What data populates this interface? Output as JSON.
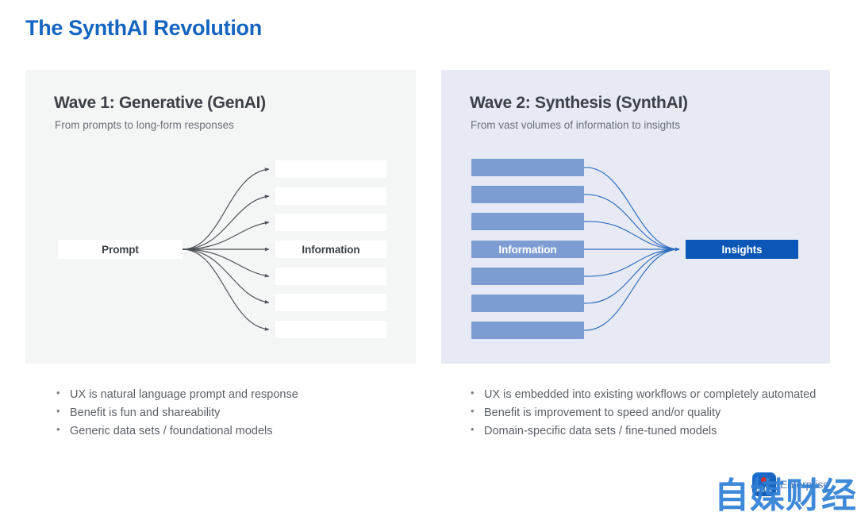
{
  "slide": {
    "title": "The SynthAI Revolution",
    "colors": {
      "title_blue": "#1565c0",
      "left_panel_bg": "#f4f5f5",
      "right_panel_bg": "#e7eaf4",
      "bar_blue": "#7d9cd2",
      "insights_blue": "#0b57b8",
      "arrow_gray": "#4a4f55",
      "arrow_blue": "#2c6bbd",
      "body_text": "#5c6066",
      "heading_text": "#3c4148"
    }
  },
  "panels": [
    {
      "id": "wave1",
      "title": "Wave 1: Generative (GenAI)",
      "subtitle": "From prompts to long-form responses",
      "source_node": "Prompt",
      "target_label": "Information",
      "bar_count": 7,
      "labeled_bar_index": 3,
      "flow_direction": "one-to-many",
      "bullets": [
        "UX is natural language prompt and response",
        "Benefit is fun and shareability",
        "Generic data sets / foundational models"
      ]
    },
    {
      "id": "wave2",
      "title": "Wave 2: Synthesis (SynthAI)",
      "subtitle": "From vast volumes of information to insights",
      "source_label": "Information",
      "target_node": "Insights",
      "bar_count": 7,
      "labeled_bar_index": 3,
      "flow_direction": "many-to-one",
      "bullets": [
        "UX is embedded into existing workflows or completely automated",
        "Benefit is improvement to speed and/or quality",
        "Domain-specific data sets / fine-tuned models"
      ]
    }
  ],
  "logo": {
    "mark_text": "a16z",
    "wordmark": "Enterprise",
    "watermark_text": "自媒财经"
  }
}
